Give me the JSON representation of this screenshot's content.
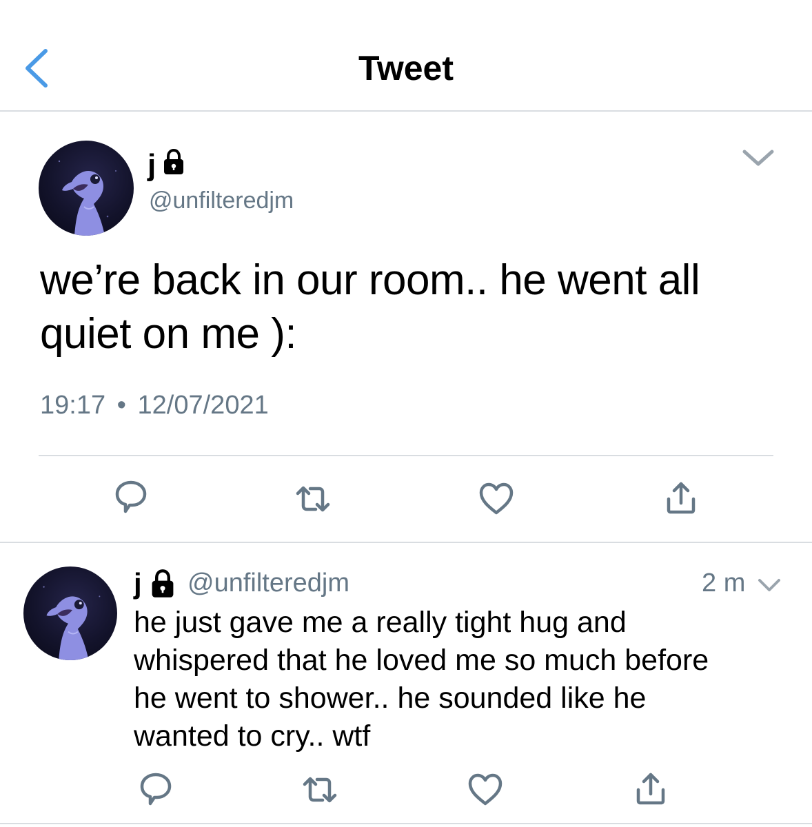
{
  "header": {
    "title": "Tweet",
    "back_icon": "chevron-left-icon",
    "accent": "#4a9ae6"
  },
  "main_tweet": {
    "display_name": "j",
    "protected_icon": "lock-icon",
    "handle": "@unfilteredjm",
    "text_lines": [
      "we’re back in our room.. he went all",
      "quiet on me ):"
    ],
    "time": "19:17",
    "separator": "•",
    "date": "12/07/2021",
    "actions": [
      "reply-icon",
      "retweet-icon",
      "like-icon",
      "share-icon"
    ]
  },
  "reply_tweet": {
    "display_name": "j",
    "protected_icon": "lock-icon",
    "handle": "@unfilteredjm",
    "age": "2 m",
    "text_lines": [
      "he just gave me a really tight hug and",
      "whispered that he loved me so much before",
      "he went to shower.. he sounded like he",
      "wanted to cry.. wtf"
    ],
    "actions": [
      "reply-icon",
      "retweet-icon",
      "like-icon",
      "share-icon"
    ]
  },
  "colors": {
    "secondary_text": "#657786",
    "icon_gray": "#657786",
    "divider": "#d9dde1"
  }
}
